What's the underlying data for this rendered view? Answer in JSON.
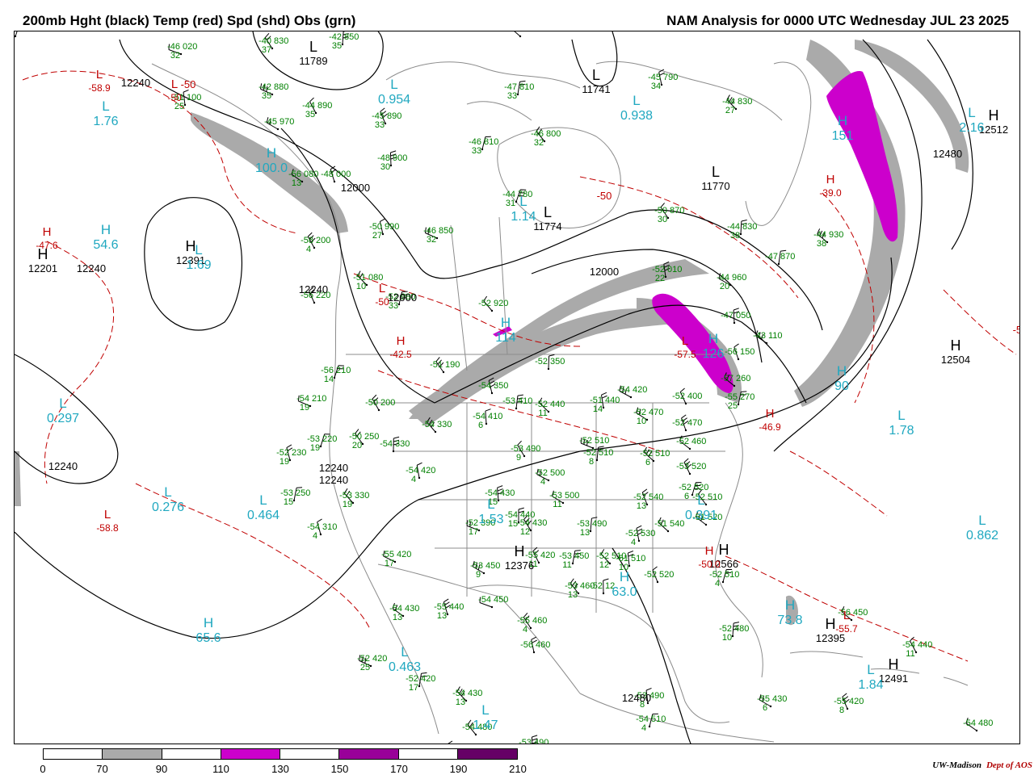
{
  "title_left": "200mb Hght (black) Temp (red) Spd (shd) Obs (grn)",
  "title_right": "NAM Analysis for 0000 UTC Wednesday  JUL 23 2025",
  "credit": {
    "org": "UW-Madison",
    "dept": "Dept of AOS"
  },
  "colors": {
    "height": "#000000",
    "temp": "#c00000",
    "obs": "#008000",
    "pressure": "#20a8c0",
    "shade_70": "#aaaaaa",
    "shade_110": "#cc00cc",
    "shade_150": "#990099",
    "shade_190": "#660066",
    "coast": "#8c8c8c"
  },
  "legend": {
    "ticks": [
      "0",
      "70",
      "90",
      "110",
      "130",
      "150",
      "170",
      "190",
      "210"
    ],
    "segments": [
      {
        "from": "0",
        "to": "70",
        "color": "#ffffff"
      },
      {
        "from": "70",
        "to": "90",
        "color": "#aaaaaa"
      },
      {
        "from": "90",
        "to": "110",
        "color": "#ffffff"
      },
      {
        "from": "110",
        "to": "130",
        "color": "#cc00cc"
      },
      {
        "from": "130",
        "to": "150",
        "color": "#ffffff"
      },
      {
        "from": "150",
        "to": "170",
        "color": "#990099"
      },
      {
        "from": "170",
        "to": "190",
        "color": "#ffffff"
      },
      {
        "from": "190",
        "to": "210",
        "color": "#660066"
      }
    ]
  },
  "centers": [
    {
      "kind": "H",
      "role": "height",
      "value": "12391"
    },
    {
      "kind": "H",
      "role": "height",
      "value": "12201"
    },
    {
      "kind": "H",
      "role": "height",
      "value": "12512"
    },
    {
      "kind": "H",
      "role": "height",
      "value": "12504"
    },
    {
      "kind": "L",
      "role": "height",
      "value": "11741"
    },
    {
      "kind": "L",
      "role": "height",
      "value": "11770"
    },
    {
      "kind": "L",
      "role": "height",
      "value": "11774"
    },
    {
      "kind": "L",
      "role": "height",
      "value": "11789"
    },
    {
      "kind": "H",
      "role": "height",
      "value": "12376"
    },
    {
      "kind": "H",
      "role": "height",
      "value": "12566"
    },
    {
      "kind": "H",
      "role": "height",
      "value": "12491"
    },
    {
      "kind": "H",
      "role": "height",
      "value": "12395"
    }
  ],
  "speed_centers": [
    {
      "kind": "L",
      "value": "1.76"
    },
    {
      "kind": "H",
      "value": "100.0"
    },
    {
      "kind": "L",
      "value": "0.954"
    },
    {
      "kind": "L",
      "value": "0.938"
    },
    {
      "kind": "L",
      "value": "2.16"
    },
    {
      "kind": "H",
      "value": "151"
    },
    {
      "kind": "H",
      "value": "54.6"
    },
    {
      "kind": "L",
      "value": "1.69"
    },
    {
      "kind": "L",
      "value": "1.14"
    },
    {
      "kind": "H",
      "value": "114"
    },
    {
      "kind": "H",
      "value": "126"
    },
    {
      "kind": "L",
      "value": "0.297"
    },
    {
      "kind": "L",
      "value": "0.276"
    },
    {
      "kind": "L",
      "value": "0.464"
    },
    {
      "kind": "L",
      "value": "1.53"
    },
    {
      "kind": "L",
      "value": "0.391"
    },
    {
      "kind": "L",
      "value": "1.78"
    },
    {
      "kind": "L",
      "value": "0.862"
    },
    {
      "kind": "H",
      "value": "65.6"
    },
    {
      "kind": "L",
      "value": "0.463"
    },
    {
      "kind": "H",
      "value": "63.0"
    },
    {
      "kind": "H",
      "value": "73.8"
    },
    {
      "kind": "L",
      "value": "1.84"
    },
    {
      "kind": "L",
      "value": "1.47"
    },
    {
      "kind": "H",
      "value": "90"
    }
  ],
  "temp_centers": [
    {
      "kind": "L",
      "value": "-58.9"
    },
    {
      "kind": "H",
      "value": "-47.6"
    },
    {
      "kind": "L",
      "value": "-50"
    },
    {
      "kind": "H",
      "value": "-42.5"
    },
    {
      "kind": "H",
      "value": "-39.0"
    },
    {
      "kind": "L",
      "value": "-57.5"
    },
    {
      "kind": "H",
      "value": "-46.9"
    },
    {
      "kind": "L",
      "value": "-58.8"
    },
    {
      "kind": "H",
      "value": "-50.0"
    },
    {
      "kind": "L",
      "value": "-55.7"
    },
    {
      "kind": "L",
      "value": "-50"
    }
  ],
  "contour_labels": [
    {
      "value": "12240"
    },
    {
      "value": "12240"
    },
    {
      "value": "12000"
    },
    {
      "value": "12240"
    },
    {
      "value": "12000"
    },
    {
      "value": "12000"
    },
    {
      "value": "12480"
    },
    {
      "value": "12240"
    },
    {
      "value": "12240"
    },
    {
      "value": "12240"
    },
    {
      "value": "12480"
    },
    {
      "value": "-50"
    },
    {
      "value": "-50"
    },
    {
      "value": "-50"
    }
  ],
  "obs": [
    {
      "t": "-46",
      "h": "020",
      "d": "32"
    },
    {
      "t": "-40",
      "h": "830",
      "d": "37"
    },
    {
      "t": "-42",
      "h": "850",
      "d": "35"
    },
    {
      "t": "-44",
      "h": "610",
      "d": ""
    },
    {
      "t": "-45",
      "h": "790",
      "d": "34"
    },
    {
      "t": "-42",
      "h": "880",
      "d": "35"
    },
    {
      "t": "-44",
      "h": "890",
      "d": "35"
    },
    {
      "t": "-47",
      "h": "810",
      "d": "33"
    },
    {
      "t": "-44",
      "h": "830",
      "d": "27"
    },
    {
      "t": "-51",
      "h": "100",
      "d": "25"
    },
    {
      "t": "-45",
      "h": "970",
      "d": ""
    },
    {
      "t": "-45",
      "h": "890",
      "d": "33"
    },
    {
      "t": "-46",
      "h": "810",
      "d": "33"
    },
    {
      "t": "-46",
      "h": "800",
      "d": "32"
    },
    {
      "t": "-48",
      "h": "900",
      "d": "30"
    },
    {
      "t": "-56",
      "h": "080",
      "d": "13"
    },
    {
      "t": "-48",
      "h": "000",
      "d": ""
    },
    {
      "t": "-44",
      "h": "780",
      "d": "31"
    },
    {
      "t": "-50",
      "h": "870",
      "d": "30"
    },
    {
      "t": "-44",
      "h": "830",
      "d": "38"
    },
    {
      "t": "-44",
      "h": "930",
      "d": "38"
    },
    {
      "t": "-50",
      "h": "990",
      "d": "27"
    },
    {
      "t": "-46",
      "h": "850",
      "d": "32"
    },
    {
      "t": "-58",
      "h": "200",
      "d": "4"
    },
    {
      "t": "-47",
      "h": "870",
      "d": ""
    },
    {
      "t": "-51",
      "h": "080",
      "d": "10"
    },
    {
      "t": "-52",
      "h": "010",
      "d": "22"
    },
    {
      "t": "-44",
      "h": "960",
      "d": "20"
    },
    {
      "t": "-56",
      "h": "220",
      "d": ""
    },
    {
      "t": "-52",
      "h": "980",
      "d": "33"
    },
    {
      "t": "-52",
      "h": "920",
      "d": ""
    },
    {
      "t": "-47",
      "h": "050",
      "d": ""
    },
    {
      "t": "-43",
      "h": "110",
      "d": ""
    },
    {
      "t": "-56",
      "h": "150",
      "d": ""
    },
    {
      "t": "-56",
      "h": "210",
      "d": "14"
    },
    {
      "t": "-51",
      "h": "190",
      "d": ""
    },
    {
      "t": "-52",
      "h": "350",
      "d": ""
    },
    {
      "t": "-57",
      "h": "260",
      "d": ""
    },
    {
      "t": "-54",
      "h": "350",
      "d": ""
    },
    {
      "t": "-54",
      "h": "210",
      "d": "19"
    },
    {
      "t": "-50",
      "h": "200",
      "d": ""
    },
    {
      "t": "-53",
      "h": "410",
      "d": ""
    },
    {
      "t": "-52",
      "h": "440",
      "d": "11"
    },
    {
      "t": "-51",
      "h": "440",
      "d": "14"
    },
    {
      "t": "-54",
      "h": "420",
      "d": ""
    },
    {
      "t": "-52",
      "h": "400",
      "d": ""
    },
    {
      "t": "-55",
      "h": "270",
      "d": "25"
    },
    {
      "t": "-54",
      "h": "330",
      "d": ""
    },
    {
      "t": "-54",
      "h": "410",
      "d": "6"
    },
    {
      "t": "-52",
      "h": "470",
      "d": "10"
    },
    {
      "t": "-52",
      "h": "470",
      "d": ""
    },
    {
      "t": "-53",
      "h": "220",
      "d": "19"
    },
    {
      "t": "-50",
      "h": "250",
      "d": "20"
    },
    {
      "t": "-54",
      "h": "330",
      "d": ""
    },
    {
      "t": "-52",
      "h": "460",
      "d": ""
    },
    {
      "t": "-52",
      "h": "230",
      "d": "19"
    },
    {
      "t": "-52",
      "h": "510",
      "d": ""
    },
    {
      "t": "-53",
      "h": "490",
      "d": "9"
    },
    {
      "t": "-52",
      "h": "510",
      "d": "8"
    },
    {
      "t": "-52",
      "h": "510",
      "d": "6"
    },
    {
      "t": "-54",
      "h": "420",
      "d": "4"
    },
    {
      "t": "-52",
      "h": "500",
      "d": "4"
    },
    {
      "t": "-53",
      "h": "520",
      "d": ""
    },
    {
      "t": "-53",
      "h": "250",
      "d": "15"
    },
    {
      "t": "-53",
      "h": "330",
      "d": "19"
    },
    {
      "t": "-54",
      "h": "430",
      "d": "15"
    },
    {
      "t": "-53",
      "h": "500",
      "d": "11"
    },
    {
      "t": "-52",
      "h": "540",
      "d": "13"
    },
    {
      "t": "-52",
      "h": "520",
      "d": "6"
    },
    {
      "t": "-52",
      "h": "510",
      "d": ""
    },
    {
      "t": "-54",
      "h": "440",
      "d": "15"
    },
    {
      "t": "-51",
      "h": "520",
      "d": ""
    },
    {
      "t": "-54",
      "h": "310",
      "d": "4"
    },
    {
      "t": "-52",
      "h": "390",
      "d": "17"
    },
    {
      "t": "-54",
      "h": "430",
      "d": "12"
    },
    {
      "t": "-53",
      "h": "490",
      "d": "13"
    },
    {
      "t": "-51",
      "h": "540",
      "d": ""
    },
    {
      "t": "-52",
      "h": "530",
      "d": "4"
    },
    {
      "t": "-55",
      "h": "420",
      "d": "17"
    },
    {
      "t": "-55",
      "h": "420",
      "d": "11"
    },
    {
      "t": "-53",
      "h": "450",
      "d": "11"
    },
    {
      "t": "-52",
      "h": "510",
      "d": "12"
    },
    {
      "t": "-51",
      "h": "510",
      "d": "10"
    },
    {
      "t": "-53",
      "h": "450",
      "d": "9"
    },
    {
      "t": "-52",
      "h": "520",
      "d": ""
    },
    {
      "t": "-52",
      "h": "510",
      "d": "4"
    },
    {
      "t": "-53",
      "h": "460",
      "d": "13"
    },
    {
      "t": "-52",
      "h": "12",
      "d": ""
    },
    {
      "t": "-54",
      "h": "430",
      "d": "13"
    },
    {
      "t": "-55",
      "h": "440",
      "d": "13"
    },
    {
      "t": "-54",
      "h": "450",
      "d": ""
    },
    {
      "t": "-55",
      "h": "460",
      "d": "4"
    },
    {
      "t": "-52",
      "h": "480",
      "d": "10"
    },
    {
      "t": "-56",
      "h": "450",
      "d": ""
    },
    {
      "t": "-56",
      "h": "460",
      "d": ""
    },
    {
      "t": "-52",
      "h": "420",
      "d": "25"
    },
    {
      "t": "-54",
      "h": "440",
      "d": "11"
    },
    {
      "t": "-52",
      "h": "420",
      "d": "17"
    },
    {
      "t": "-54",
      "h": "430",
      "d": "13"
    },
    {
      "t": "-53",
      "h": "490",
      "d": "8"
    },
    {
      "t": "-55",
      "h": "430",
      "d": "6"
    },
    {
      "t": "-55",
      "h": "420",
      "d": "8"
    },
    {
      "t": "-54",
      "h": "510",
      "d": "4"
    },
    {
      "t": "-54",
      "h": "480",
      "d": ""
    },
    {
      "t": "-53",
      "h": "490",
      "d": ""
    },
    {
      "t": "-54",
      "h": "480",
      "d": ""
    },
    {
      "t": "-54",
      "h": "500",
      "d": ""
    },
    {
      "t": "-53",
      "h": "",
      "d": ""
    }
  ]
}
